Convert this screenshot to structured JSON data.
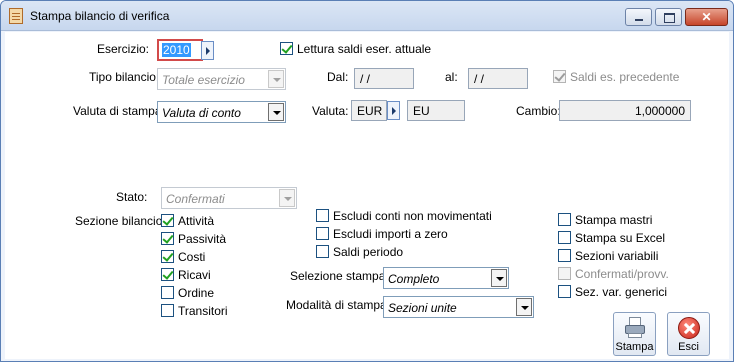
{
  "window": {
    "title": "Stampa bilancio di verifica",
    "close_glyph": "✕"
  },
  "form": {
    "esercizio_label": "Esercizio:",
    "esercizio_value": "2010",
    "lettura_saldi_label": "Lettura saldi eser. attuale",
    "lettura_saldi_checked": true,
    "tipo_bilancio_label": "Tipo bilancio:",
    "tipo_bilancio_value": "Totale esercizio",
    "dal_label": "Dal:",
    "dal_value": "/ /",
    "al_label": "al:",
    "al_value": "/ /",
    "saldi_prec_label": "Saldi es. precedente",
    "saldi_prec_checked": true,
    "valuta_stampa_label": "Valuta di stampa:",
    "valuta_stampa_value": "Valuta di conto",
    "valuta_label": "Valuta:",
    "valuta_code": "EUR",
    "valuta_desc": "EU",
    "cambio_label": "Cambio:",
    "cambio_value": "1,000000",
    "stato_label": "Stato:",
    "stato_value": "Confermati",
    "sezione_label": "Sezione bilancio:",
    "sezioni": [
      {
        "label": "Attività",
        "checked": true
      },
      {
        "label": "Passività",
        "checked": true
      },
      {
        "label": "Costi",
        "checked": true
      },
      {
        "label": "Ricavi",
        "checked": true
      },
      {
        "label": "Ordine",
        "checked": false
      },
      {
        "label": "Transitori",
        "checked": false
      }
    ],
    "middle_checks": [
      {
        "label": "Escludi conti non movimentati",
        "checked": false
      },
      {
        "label": "Escludi importi a zero",
        "checked": false
      },
      {
        "label": "Saldi periodo",
        "checked": false
      }
    ],
    "right_checks": [
      {
        "label": "Stampa mastri",
        "checked": false,
        "disabled": false
      },
      {
        "label": "Stampa su Excel",
        "checked": false,
        "disabled": false
      },
      {
        "label": "Sezioni variabili",
        "checked": false,
        "disabled": false
      },
      {
        "label": "Confermati/provv.",
        "checked": false,
        "disabled": true
      },
      {
        "label": "Sez. var. generici",
        "checked": false,
        "disabled": false
      }
    ],
    "selezione_label": "Selezione stampa:",
    "selezione_value": "Completo",
    "modalita_label": "Modalità di stampa:",
    "modalita_value": "Sezioni unite"
  },
  "buttons": {
    "stampa_label": "Stampa",
    "esci_label": "Esci"
  },
  "icons": {
    "title": "report-icon",
    "stampa": "printer-icon",
    "esci": "close-circle-icon"
  }
}
